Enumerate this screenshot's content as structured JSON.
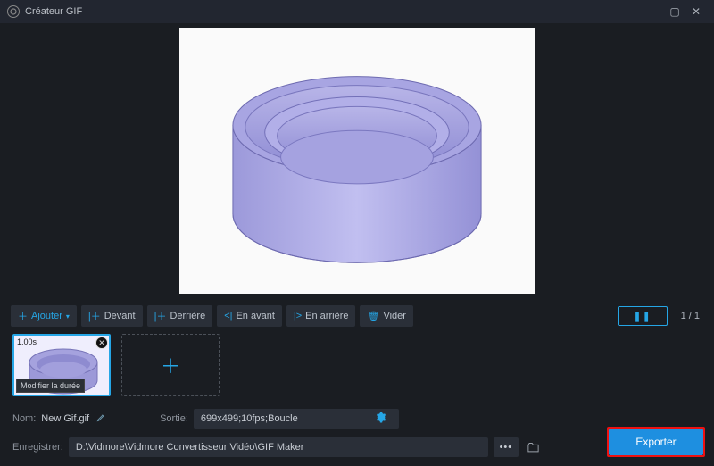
{
  "window": {
    "title": "Créateur GIF"
  },
  "toolbar": {
    "add": "Ajouter",
    "front": "Devant",
    "back": "Derrière",
    "forward": "En avant",
    "backward": "En arrière",
    "clear": "Vider"
  },
  "playback": {
    "pause_glyph": "❚❚",
    "counter": "1 / 1"
  },
  "thumbs": {
    "first_duration": "1.00s",
    "tooltip": "Modifier la durée"
  },
  "form": {
    "name_label": "Nom:",
    "name_value": "New Gif.gif",
    "output_label": "Sortie:",
    "output_value": "699x499;10fps;Boucle",
    "save_label": "Enregistrer:",
    "save_value": "D:\\Vidmore\\Vidmore Convertisseur Vidéo\\GIF Maker"
  },
  "export": {
    "label": "Exporter"
  },
  "colors": {
    "accent": "#25a6e6",
    "export_bg": "#1e8fe0",
    "highlight_border": "#e11"
  }
}
